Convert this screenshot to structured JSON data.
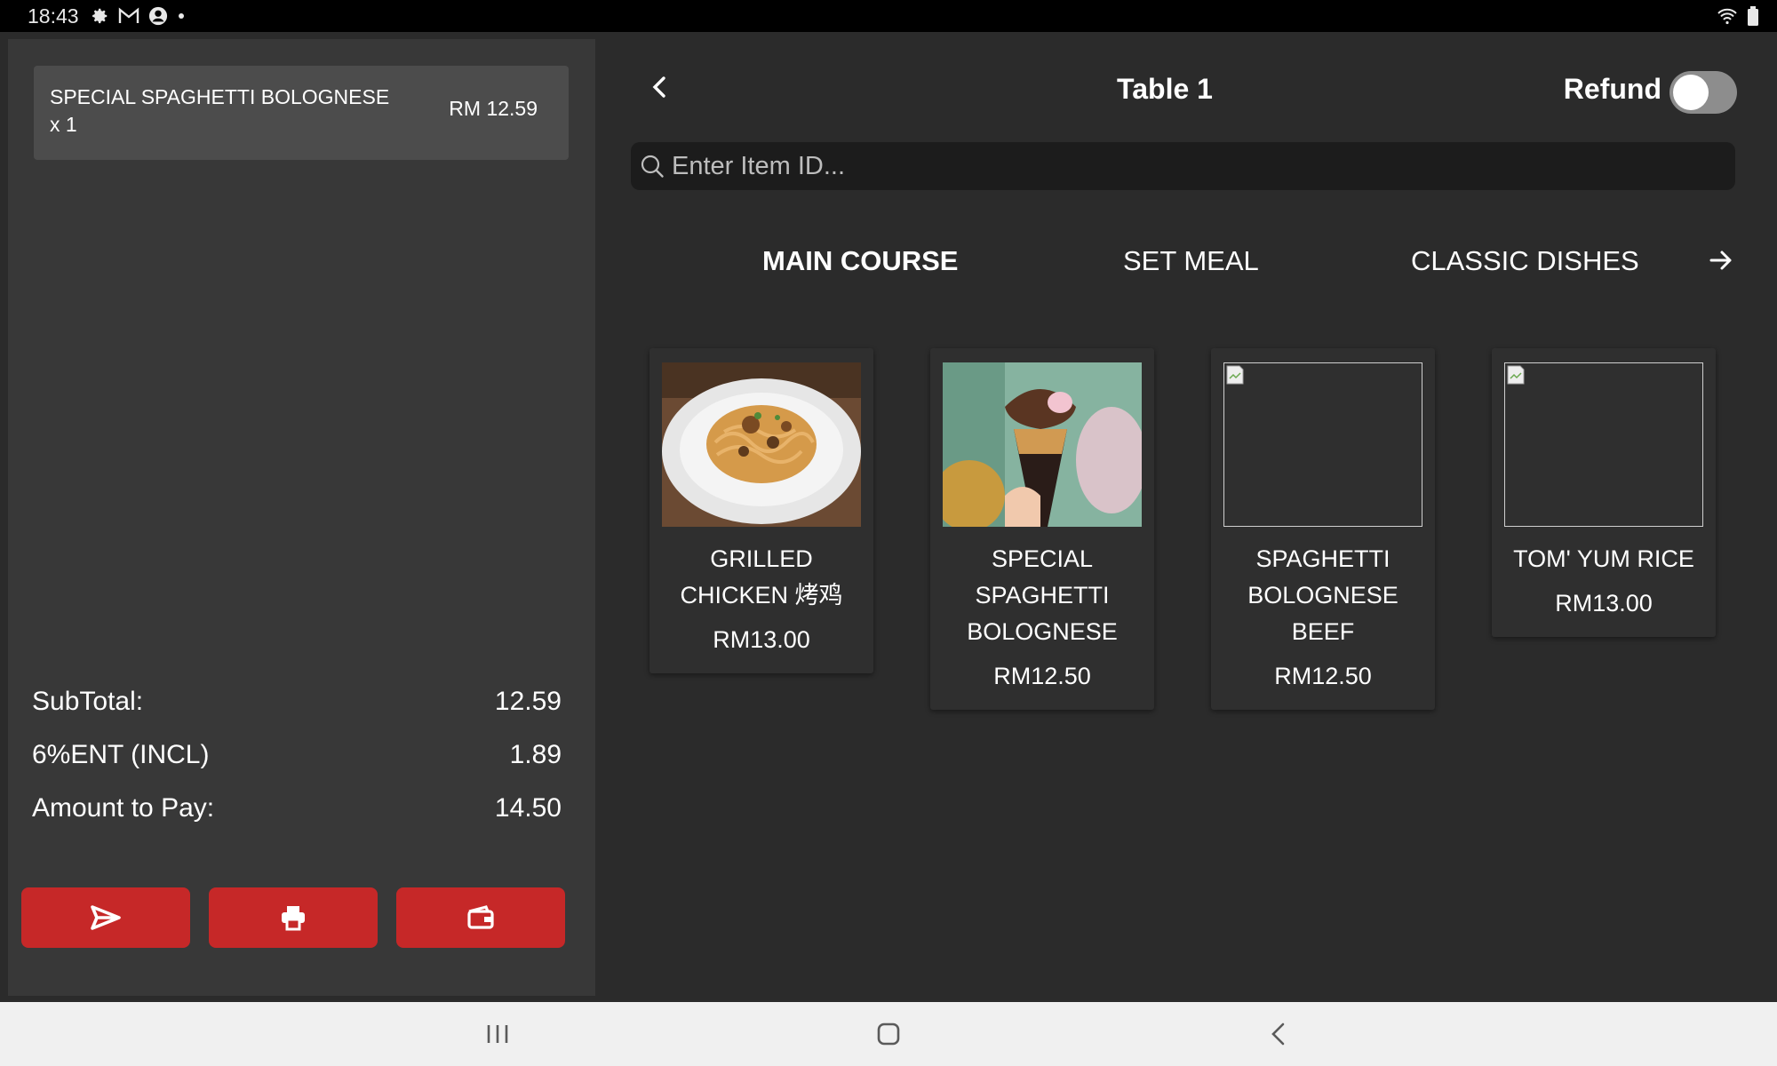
{
  "status_bar": {
    "time": "18:43",
    "icons": [
      "gear-icon",
      "gmail-icon",
      "account-icon",
      "dot-icon"
    ],
    "right_icons": [
      "wifi-icon",
      "battery-icon"
    ]
  },
  "order": {
    "items": [
      {
        "name": "SPECIAL SPAGHETTI BOLOGNESE",
        "qty": "x 1",
        "price": "RM 12.59"
      }
    ],
    "totals": [
      {
        "label": "SubTotal:",
        "value": "12.59"
      },
      {
        "label": "6%ENT (INCL)",
        "value": "1.89"
      },
      {
        "label": "Amount to Pay:",
        "value": "14.50"
      }
    ],
    "actions": [
      "send-icon",
      "print-icon",
      "wallet-icon"
    ]
  },
  "header": {
    "title": "Table  1",
    "refund_label": "Refund",
    "refund_on": false
  },
  "search": {
    "placeholder": "Enter Item ID..."
  },
  "tabs": [
    {
      "label": "MAIN COURSE",
      "active": true
    },
    {
      "label": "SET MEAL",
      "active": false
    },
    {
      "label": "CLASSIC DISHES",
      "active": false
    }
  ],
  "menu_items": [
    {
      "name": "GRILLED CHICKEN 烤鸡",
      "price": "RM13.00",
      "image": "spaghetti-photo"
    },
    {
      "name": "SPECIAL SPAGHETTI BOLOGNESE",
      "price": "RM12.50",
      "image": "ice-cream-photo"
    },
    {
      "name": "SPAGHETTI BOLOGNESE BEEF",
      "price": "RM12.50",
      "image": "broken-image"
    },
    {
      "name": "TOM' YUM RICE",
      "price": "RM13.00",
      "image": "broken-image"
    }
  ],
  "colors": {
    "accent_red": "#c62828",
    "panel_bg": "#383838",
    "main_bg": "#2b2b2b"
  }
}
